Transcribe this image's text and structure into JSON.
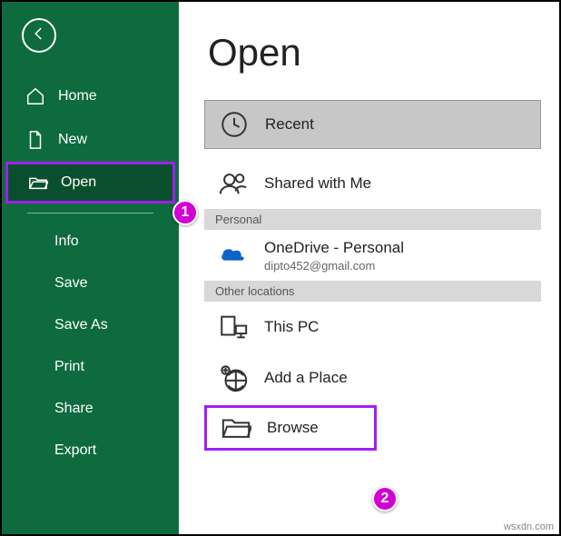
{
  "sidebar": {
    "items": [
      {
        "label": "Home"
      },
      {
        "label": "New"
      },
      {
        "label": "Open"
      }
    ],
    "sub_items": [
      {
        "label": "Info"
      },
      {
        "label": "Save"
      },
      {
        "label": "Save As"
      },
      {
        "label": "Print"
      },
      {
        "label": "Share"
      },
      {
        "label": "Export"
      }
    ]
  },
  "main": {
    "title": "Open",
    "recent_label": "Recent",
    "shared_label": "Shared with Me",
    "section_personal": "Personal",
    "onedrive": {
      "title": "OneDrive - Personal",
      "email": "dipto452@gmail.com"
    },
    "section_other": "Other locations",
    "thispc_label": "This PC",
    "addplace_label": "Add a Place",
    "browse_label": "Browse"
  },
  "callouts": {
    "one": "1",
    "two": "2"
  },
  "watermark": "wsxdn.com"
}
